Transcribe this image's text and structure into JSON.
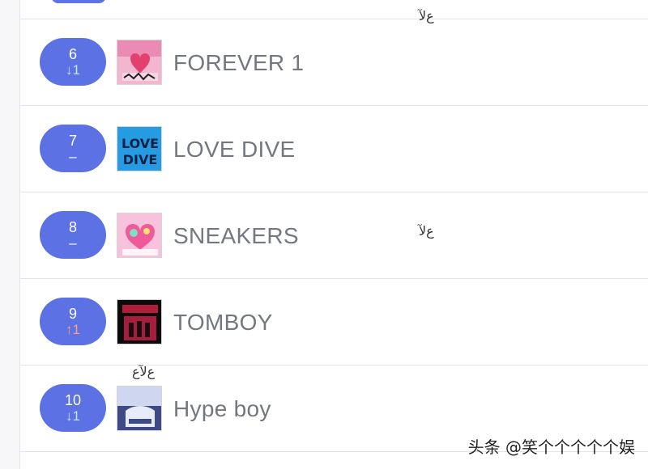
{
  "chart_list": {
    "rows": [
      {
        "rank": "6",
        "change": "↓1",
        "change_type": "down",
        "title": "FOREVER 1",
        "art": "forever1-art"
      },
      {
        "rank": "7",
        "change": "–",
        "change_type": "same",
        "title": "LOVE DIVE",
        "art": "lovedive-art"
      },
      {
        "rank": "8",
        "change": "–",
        "change_type": "same",
        "title": "SNEAKERS",
        "art": "sneakers-art"
      },
      {
        "rank": "9",
        "change": "↑1",
        "change_type": "up",
        "title": "TOMBOY",
        "art": "tomboy-art"
      },
      {
        "rank": "10",
        "change": "↓1",
        "change_type": "down",
        "title": "Hype boy",
        "art": "hypeboy-art"
      }
    ]
  },
  "watermark": {
    "text": "头条 @笑个个个个个娱"
  },
  "colors": {
    "pill": "#5c72e4",
    "title": "#737880",
    "down": "#bfe6ff",
    "up": "#f7a27c",
    "divider": "#e3e5ea"
  }
}
